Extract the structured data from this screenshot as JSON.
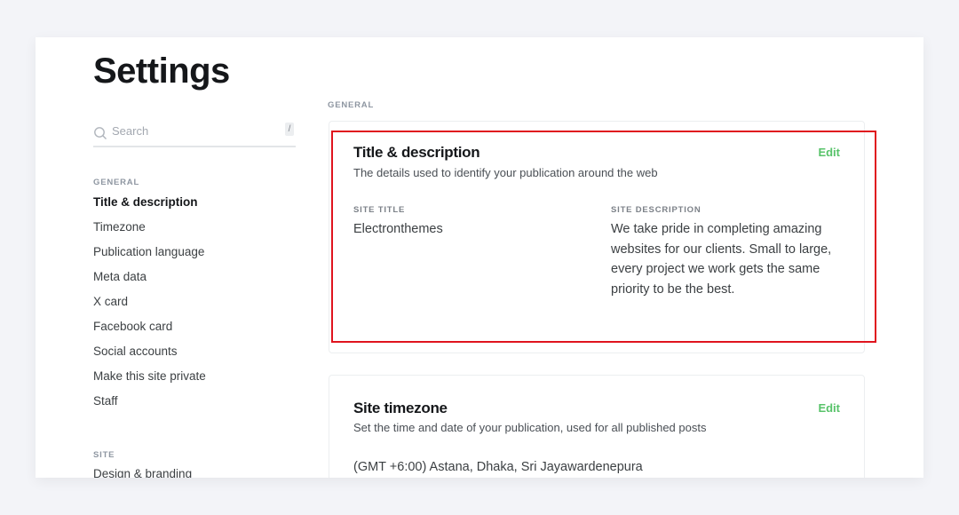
{
  "page": {
    "title": "Settings"
  },
  "search": {
    "placeholder": "Search",
    "shortcut": "/"
  },
  "sidebar": {
    "sections": [
      {
        "label": "GENERAL",
        "items": [
          {
            "label": "Title & description",
            "active": true
          },
          {
            "label": "Timezone"
          },
          {
            "label": "Publication language"
          },
          {
            "label": "Meta data"
          },
          {
            "label": "X card"
          },
          {
            "label": "Facebook card"
          },
          {
            "label": "Social accounts"
          },
          {
            "label": "Make this site private"
          },
          {
            "label": "Staff"
          }
        ]
      },
      {
        "label": "SITE",
        "items": [
          {
            "label": "Design & branding"
          }
        ]
      }
    ]
  },
  "main": {
    "section_label": "GENERAL",
    "cards": [
      {
        "title": "Title & description",
        "description": "The details used to identify your publication around the web",
        "edit_label": "Edit",
        "fields": [
          {
            "label": "SITE TITLE",
            "value": "Electronthemes"
          },
          {
            "label": "SITE DESCRIPTION",
            "value": "We take pride in completing amazing websites for our clients. Small to large, every project we work gets the same priority to be the best."
          }
        ]
      },
      {
        "title": "Site timezone",
        "description": "Set the time and date of your publication, used for all published posts",
        "edit_label": "Edit",
        "value": "(GMT +6:00) Astana, Dhaka, Sri Jayawardenepura"
      }
    ]
  },
  "colors": {
    "accent_green": "#58c36a",
    "highlight_red": "#e0141e",
    "background": "#f3f4f8"
  }
}
